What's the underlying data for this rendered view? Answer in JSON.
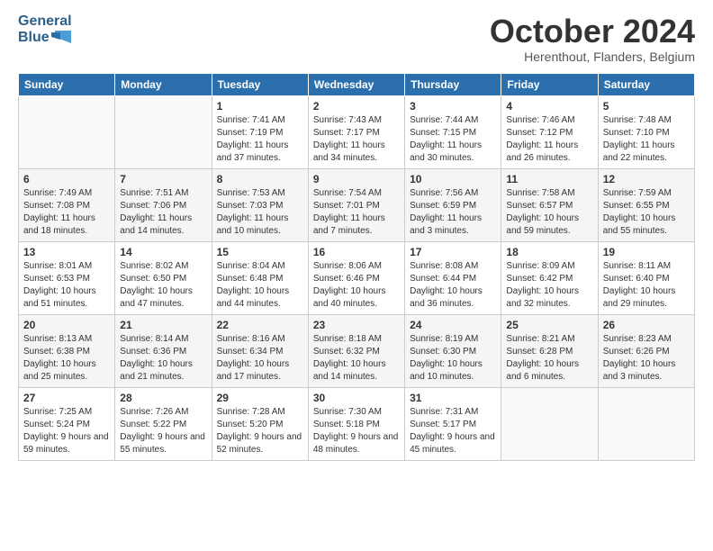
{
  "header": {
    "logo_line1": "General",
    "logo_line2": "Blue",
    "month_title": "October 2024",
    "location": "Herenthout, Flanders, Belgium"
  },
  "days_of_week": [
    "Sunday",
    "Monday",
    "Tuesday",
    "Wednesday",
    "Thursday",
    "Friday",
    "Saturday"
  ],
  "weeks": [
    [
      {
        "day": "",
        "sunrise": "",
        "sunset": "",
        "daylight": ""
      },
      {
        "day": "",
        "sunrise": "",
        "sunset": "",
        "daylight": ""
      },
      {
        "day": "1",
        "sunrise": "Sunrise: 7:41 AM",
        "sunset": "Sunset: 7:19 PM",
        "daylight": "Daylight: 11 hours and 37 minutes."
      },
      {
        "day": "2",
        "sunrise": "Sunrise: 7:43 AM",
        "sunset": "Sunset: 7:17 PM",
        "daylight": "Daylight: 11 hours and 34 minutes."
      },
      {
        "day": "3",
        "sunrise": "Sunrise: 7:44 AM",
        "sunset": "Sunset: 7:15 PM",
        "daylight": "Daylight: 11 hours and 30 minutes."
      },
      {
        "day": "4",
        "sunrise": "Sunrise: 7:46 AM",
        "sunset": "Sunset: 7:12 PM",
        "daylight": "Daylight: 11 hours and 26 minutes."
      },
      {
        "day": "5",
        "sunrise": "Sunrise: 7:48 AM",
        "sunset": "Sunset: 7:10 PM",
        "daylight": "Daylight: 11 hours and 22 minutes."
      }
    ],
    [
      {
        "day": "6",
        "sunrise": "Sunrise: 7:49 AM",
        "sunset": "Sunset: 7:08 PM",
        "daylight": "Daylight: 11 hours and 18 minutes."
      },
      {
        "day": "7",
        "sunrise": "Sunrise: 7:51 AM",
        "sunset": "Sunset: 7:06 PM",
        "daylight": "Daylight: 11 hours and 14 minutes."
      },
      {
        "day": "8",
        "sunrise": "Sunrise: 7:53 AM",
        "sunset": "Sunset: 7:03 PM",
        "daylight": "Daylight: 11 hours and 10 minutes."
      },
      {
        "day": "9",
        "sunrise": "Sunrise: 7:54 AM",
        "sunset": "Sunset: 7:01 PM",
        "daylight": "Daylight: 11 hours and 7 minutes."
      },
      {
        "day": "10",
        "sunrise": "Sunrise: 7:56 AM",
        "sunset": "Sunset: 6:59 PM",
        "daylight": "Daylight: 11 hours and 3 minutes."
      },
      {
        "day": "11",
        "sunrise": "Sunrise: 7:58 AM",
        "sunset": "Sunset: 6:57 PM",
        "daylight": "Daylight: 10 hours and 59 minutes."
      },
      {
        "day": "12",
        "sunrise": "Sunrise: 7:59 AM",
        "sunset": "Sunset: 6:55 PM",
        "daylight": "Daylight: 10 hours and 55 minutes."
      }
    ],
    [
      {
        "day": "13",
        "sunrise": "Sunrise: 8:01 AM",
        "sunset": "Sunset: 6:53 PM",
        "daylight": "Daylight: 10 hours and 51 minutes."
      },
      {
        "day": "14",
        "sunrise": "Sunrise: 8:02 AM",
        "sunset": "Sunset: 6:50 PM",
        "daylight": "Daylight: 10 hours and 47 minutes."
      },
      {
        "day": "15",
        "sunrise": "Sunrise: 8:04 AM",
        "sunset": "Sunset: 6:48 PM",
        "daylight": "Daylight: 10 hours and 44 minutes."
      },
      {
        "day": "16",
        "sunrise": "Sunrise: 8:06 AM",
        "sunset": "Sunset: 6:46 PM",
        "daylight": "Daylight: 10 hours and 40 minutes."
      },
      {
        "day": "17",
        "sunrise": "Sunrise: 8:08 AM",
        "sunset": "Sunset: 6:44 PM",
        "daylight": "Daylight: 10 hours and 36 minutes."
      },
      {
        "day": "18",
        "sunrise": "Sunrise: 8:09 AM",
        "sunset": "Sunset: 6:42 PM",
        "daylight": "Daylight: 10 hours and 32 minutes."
      },
      {
        "day": "19",
        "sunrise": "Sunrise: 8:11 AM",
        "sunset": "Sunset: 6:40 PM",
        "daylight": "Daylight: 10 hours and 29 minutes."
      }
    ],
    [
      {
        "day": "20",
        "sunrise": "Sunrise: 8:13 AM",
        "sunset": "Sunset: 6:38 PM",
        "daylight": "Daylight: 10 hours and 25 minutes."
      },
      {
        "day": "21",
        "sunrise": "Sunrise: 8:14 AM",
        "sunset": "Sunset: 6:36 PM",
        "daylight": "Daylight: 10 hours and 21 minutes."
      },
      {
        "day": "22",
        "sunrise": "Sunrise: 8:16 AM",
        "sunset": "Sunset: 6:34 PM",
        "daylight": "Daylight: 10 hours and 17 minutes."
      },
      {
        "day": "23",
        "sunrise": "Sunrise: 8:18 AM",
        "sunset": "Sunset: 6:32 PM",
        "daylight": "Daylight: 10 hours and 14 minutes."
      },
      {
        "day": "24",
        "sunrise": "Sunrise: 8:19 AM",
        "sunset": "Sunset: 6:30 PM",
        "daylight": "Daylight: 10 hours and 10 minutes."
      },
      {
        "day": "25",
        "sunrise": "Sunrise: 8:21 AM",
        "sunset": "Sunset: 6:28 PM",
        "daylight": "Daylight: 10 hours and 6 minutes."
      },
      {
        "day": "26",
        "sunrise": "Sunrise: 8:23 AM",
        "sunset": "Sunset: 6:26 PM",
        "daylight": "Daylight: 10 hours and 3 minutes."
      }
    ],
    [
      {
        "day": "27",
        "sunrise": "Sunrise: 7:25 AM",
        "sunset": "Sunset: 5:24 PM",
        "daylight": "Daylight: 9 hours and 59 minutes."
      },
      {
        "day": "28",
        "sunrise": "Sunrise: 7:26 AM",
        "sunset": "Sunset: 5:22 PM",
        "daylight": "Daylight: 9 hours and 55 minutes."
      },
      {
        "day": "29",
        "sunrise": "Sunrise: 7:28 AM",
        "sunset": "Sunset: 5:20 PM",
        "daylight": "Daylight: 9 hours and 52 minutes."
      },
      {
        "day": "30",
        "sunrise": "Sunrise: 7:30 AM",
        "sunset": "Sunset: 5:18 PM",
        "daylight": "Daylight: 9 hours and 48 minutes."
      },
      {
        "day": "31",
        "sunrise": "Sunrise: 7:31 AM",
        "sunset": "Sunset: 5:17 PM",
        "daylight": "Daylight: 9 hours and 45 minutes."
      },
      {
        "day": "",
        "sunrise": "",
        "sunset": "",
        "daylight": ""
      },
      {
        "day": "",
        "sunrise": "",
        "sunset": "",
        "daylight": ""
      }
    ]
  ]
}
